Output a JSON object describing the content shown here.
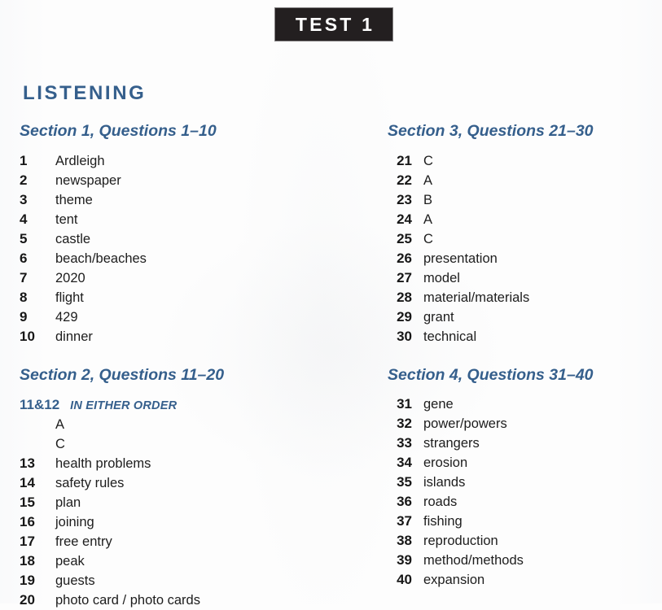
{
  "banner": {
    "label": "TEST 1"
  },
  "skill_heading": "LISTENING",
  "columns": {
    "left": [
      {
        "heading": "Section 1, Questions 1–10",
        "rows": [
          {
            "number": "1",
            "answer": "Ardleigh"
          },
          {
            "number": "2",
            "answer": "newspaper"
          },
          {
            "number": "3",
            "answer": "theme"
          },
          {
            "number": "4",
            "answer": "tent"
          },
          {
            "number": "5",
            "answer": "castle"
          },
          {
            "number": "6",
            "answer": "beach/beaches"
          },
          {
            "number": "7",
            "answer": "2020"
          },
          {
            "number": "8",
            "answer": "flight"
          },
          {
            "number": "9",
            "answer": "429"
          },
          {
            "number": "10",
            "answer": "dinner"
          }
        ]
      },
      {
        "heading": "Section 2, Questions 11–20",
        "note": {
          "number": "11&12",
          "label": "IN EITHER ORDER"
        },
        "options": [
          "A",
          "C"
        ],
        "rows": [
          {
            "number": "13",
            "answer": "health problems"
          },
          {
            "number": "14",
            "answer": "safety rules"
          },
          {
            "number": "15",
            "answer": "plan"
          },
          {
            "number": "16",
            "answer": "joining"
          },
          {
            "number": "17",
            "answer": "free entry"
          },
          {
            "number": "18",
            "answer": "peak"
          },
          {
            "number": "19",
            "answer": "guests"
          },
          {
            "number": "20",
            "answer": "photo card / photo cards"
          }
        ]
      }
    ],
    "right": [
      {
        "heading": "Section 3, Questions 21–30",
        "rows": [
          {
            "number": "21",
            "answer": "C"
          },
          {
            "number": "22",
            "answer": "A"
          },
          {
            "number": "23",
            "answer": "B"
          },
          {
            "number": "24",
            "answer": "A"
          },
          {
            "number": "25",
            "answer": "C"
          },
          {
            "number": "26",
            "answer": "presentation"
          },
          {
            "number": "27",
            "answer": "model"
          },
          {
            "number": "28",
            "answer": "material/materials"
          },
          {
            "number": "29",
            "answer": "grant"
          },
          {
            "number": "30",
            "answer": "technical"
          }
        ]
      },
      {
        "heading": "Section 4, Questions 31–40",
        "rows": [
          {
            "number": "31",
            "answer": "gene"
          },
          {
            "number": "32",
            "answer": "power/powers"
          },
          {
            "number": "33",
            "answer": "strangers"
          },
          {
            "number": "34",
            "answer": "erosion"
          },
          {
            "number": "35",
            "answer": "islands"
          },
          {
            "number": "36",
            "answer": "roads"
          },
          {
            "number": "37",
            "answer": "fishing"
          },
          {
            "number": "38",
            "answer": "reproduction"
          },
          {
            "number": "39",
            "answer": "method/methods"
          },
          {
            "number": "40",
            "answer": "expansion"
          }
        ]
      }
    ]
  },
  "colors": {
    "heading_blue": "#355f8c",
    "banner_background": "#231f20",
    "banner_text": "#ffffff",
    "answer_text": "#1d1d1d",
    "page_background": "#fdfdfd"
  }
}
